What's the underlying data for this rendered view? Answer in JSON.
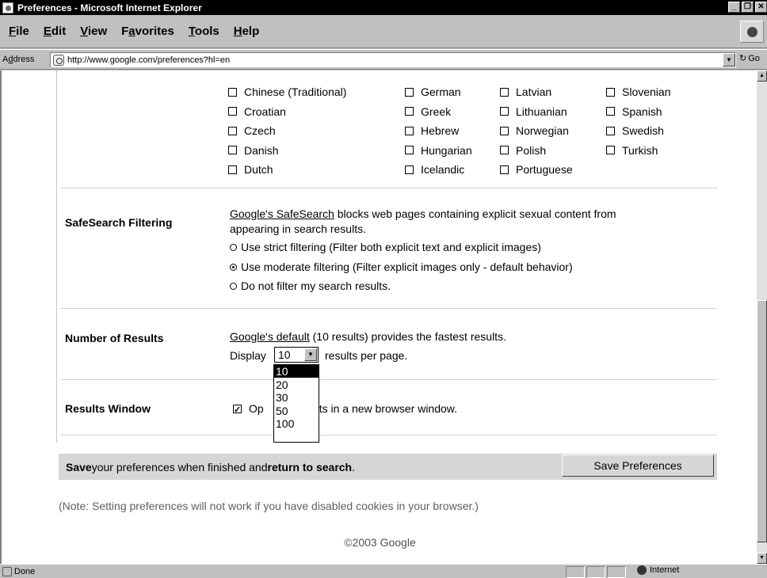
{
  "window": {
    "title": "Preferences - Microsoft Internet Explorer"
  },
  "menu": {
    "items": [
      {
        "pre": "",
        "ul": "F",
        "post": "ile"
      },
      {
        "pre": "",
        "ul": "E",
        "post": "dit"
      },
      {
        "pre": "",
        "ul": "V",
        "post": "iew"
      },
      {
        "pre": "F",
        "ul": "a",
        "post": "vorites"
      },
      {
        "pre": "",
        "ul": "T",
        "post": "ools"
      },
      {
        "pre": "",
        "ul": "H",
        "post": "elp"
      }
    ]
  },
  "address": {
    "label_pre": "A",
    "label_ul": "d",
    "label_post": "dress",
    "url": "http://www.google.com/preferences?hl=en",
    "go": "Go"
  },
  "languages": {
    "col1": [
      {
        "label": "Chinese (Traditional)",
        "checked": false
      },
      {
        "label": "Croatian",
        "checked": false
      },
      {
        "label": "Czech",
        "checked": false
      },
      {
        "label": "Danish",
        "checked": false
      },
      {
        "label": "Dutch",
        "checked": false
      }
    ],
    "col2": [
      {
        "label": "German",
        "checked": false
      },
      {
        "label": "Greek",
        "checked": false
      },
      {
        "label": "Hebrew",
        "checked": false
      },
      {
        "label": "Hungarian",
        "checked": false
      },
      {
        "label": "Icelandic",
        "checked": false
      }
    ],
    "col3": [
      {
        "label": "Latvian",
        "checked": false
      },
      {
        "label": "Lithuanian",
        "checked": false
      },
      {
        "label": "Norwegian",
        "checked": false
      },
      {
        "label": "Polish",
        "checked": false
      },
      {
        "label": "Portuguese",
        "checked": false
      }
    ],
    "col4": [
      {
        "label": "Slovenian",
        "checked": false
      },
      {
        "label": "Spanish",
        "checked": false
      },
      {
        "label": "Swedish",
        "checked": false
      },
      {
        "label": "Turkish",
        "checked": false
      }
    ]
  },
  "safesearch": {
    "title": "SafeSearch Filtering",
    "link": "Google's SafeSearch",
    "desc_line1": " blocks web pages containing explicit sexual content from",
    "desc_line2": "appearing in search results.",
    "options": [
      {
        "label": "Use strict filtering (Filter both explicit text and explicit images)",
        "selected": false
      },
      {
        "label": "Use moderate filtering (Filter explicit images only - default behavior)",
        "selected": true
      },
      {
        "label": "Do not filter my search results.",
        "selected": false
      }
    ]
  },
  "results": {
    "title": "Number of Results",
    "desc_link": "Google's default",
    "desc_rest": " (10 results) provides the fastest results.",
    "display_label": "Display",
    "selected": "10",
    "suffix": "results per page.",
    "options": [
      "10",
      "20",
      "30",
      "50",
      "100"
    ]
  },
  "window_pref": {
    "title": "Results Window",
    "label_start": "Op",
    "label_end": "h results in a new browser window.",
    "checked": true
  },
  "savebar": {
    "b1": "Save",
    "t1": " your preferences when finished and ",
    "b2": "return to search",
    "t2": ".",
    "button": "Save Preferences"
  },
  "note": "(Note: Setting preferences will not work if you have disabled cookies in your browser.)",
  "footer": "©2003 Google",
  "status": {
    "text": "Done",
    "zone": "Internet"
  }
}
